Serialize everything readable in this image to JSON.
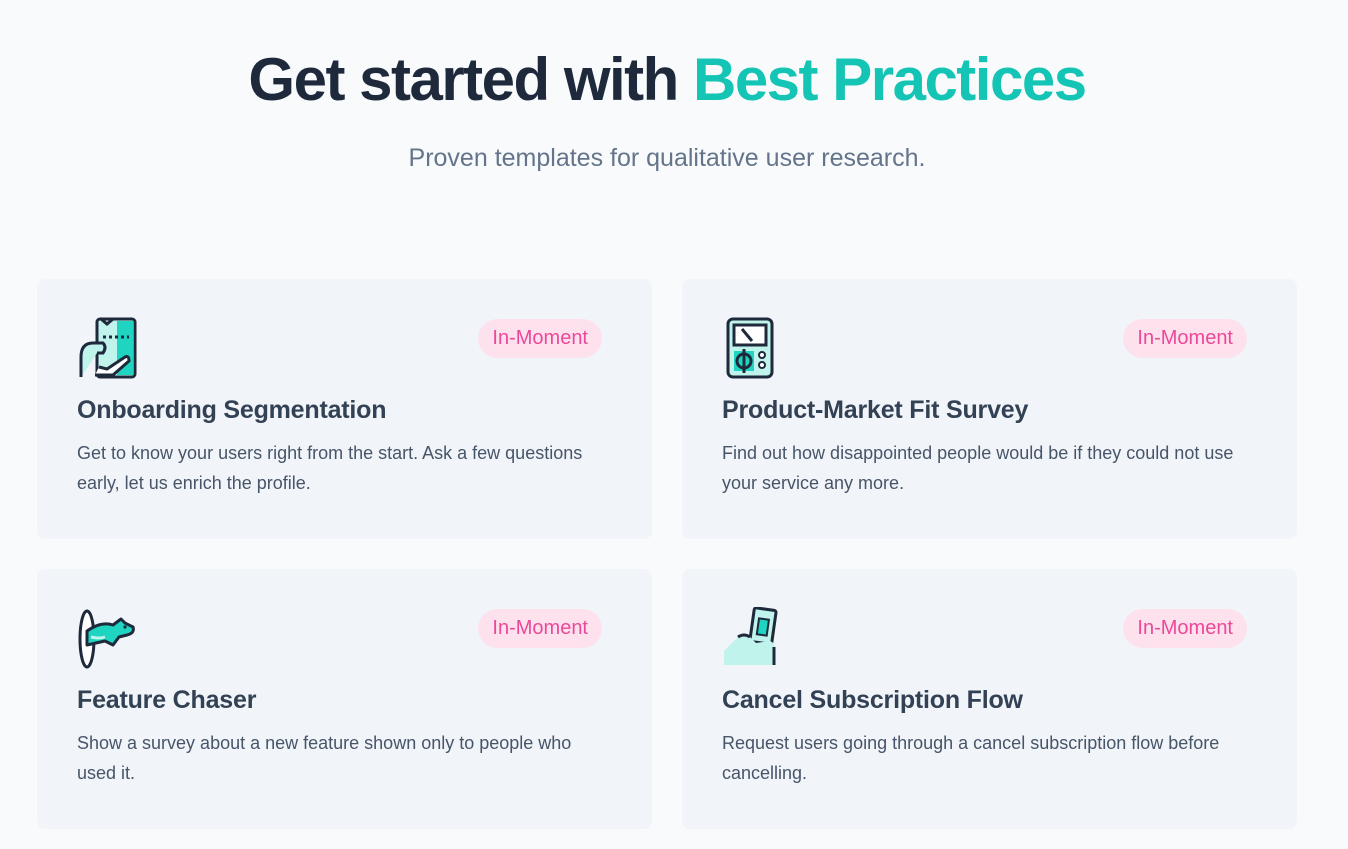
{
  "header": {
    "title_main": "Get started with ",
    "title_accent": "Best Practices",
    "subtitle": "Proven templates for qualitative user research."
  },
  "colors": {
    "heading": "#1e293b",
    "accent": "#14c4b4",
    "badge_bg": "#fde2ee",
    "badge_text": "#ec4899",
    "card_bg": "#f1f4f9"
  },
  "cards": [
    {
      "icon": "onboarding-icon",
      "badge": "In-Moment",
      "title": "Onboarding Segmentation",
      "description": "Get to know your users right from the start. Ask a few questions early, let us enrich the profile."
    },
    {
      "icon": "device-meter-icon",
      "badge": "In-Moment",
      "title": "Product-Market Fit Survey",
      "description": "Find out how disappointed people would be if they could not use your service any more."
    },
    {
      "icon": "portal-chaser-icon",
      "badge": "In-Moment",
      "title": "Feature Chaser",
      "description": "Show a survey about a new feature shown only to people who used it."
    },
    {
      "icon": "hand-phone-icon",
      "badge": "In-Moment",
      "title": "Cancel Subscription Flow",
      "description": "Request users going through a cancel subscription flow before cancelling."
    }
  ]
}
